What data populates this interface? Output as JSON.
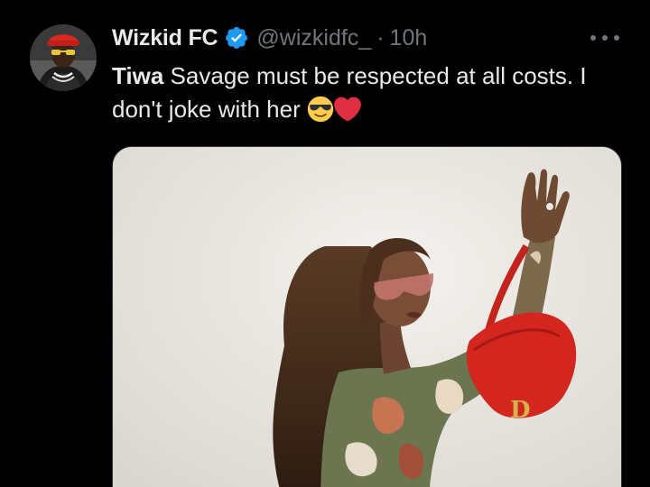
{
  "tweet": {
    "display_name": "Wizkid FC",
    "handle": "@wizkidfc_",
    "separator": "·",
    "time": "10h",
    "text_bold": "Tiwa",
    "text_rest": " Savage must be respected at all costs. I don't joke with her ",
    "emojis": [
      "sunglasses-face-emoji",
      "red-heart-emoji"
    ],
    "verified": true,
    "colors": {
      "background": "#000000",
      "text": "#e7e9ea",
      "muted": "#71767b",
      "verified_badge": "#1d9bf0",
      "heart": "#e0245e"
    }
  },
  "media": {
    "description_icon": "photo-of-woman-with-red-saddle-bag",
    "bag_letter": "D"
  }
}
